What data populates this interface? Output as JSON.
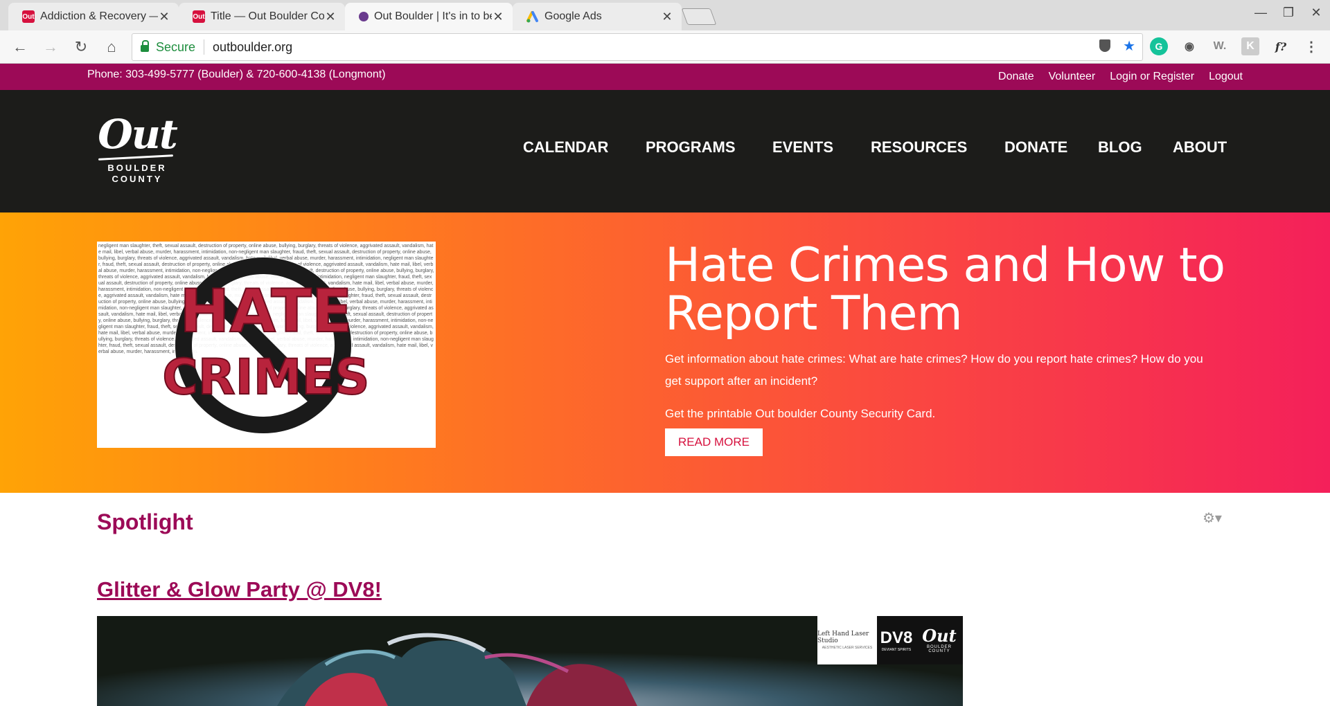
{
  "browser": {
    "tabs": [
      {
        "title": "Addiction & Recovery — O",
        "favicon_color": "#d6113e",
        "favicon_text": "Out",
        "active": false
      },
      {
        "title": "Title — Out Boulder Coun",
        "favicon_color": "#d6113e",
        "favicon_text": "Out",
        "active": false
      },
      {
        "title": "Out Boulder | It's in to be",
        "favicon_color": "#6a3b8e",
        "favicon_text": "",
        "active": true
      },
      {
        "title": "Google Ads",
        "favicon_color": "#4285f4",
        "favicon_text": "",
        "active": false
      }
    ],
    "close_glyph": "✕",
    "secure_label": "Secure",
    "url": "outboulder.org",
    "extensions": [
      "grammarly-icon",
      "evernote-icon",
      "w-icon",
      "k-icon",
      "fx-icon",
      "menu-icon"
    ],
    "ext_labels": {
      "w": "W.",
      "k": "K",
      "fx": "f?"
    }
  },
  "topbar": {
    "phone": "Phone: 303-499-5777 (Boulder) & 720-600-4138 (Longmont)",
    "links": [
      "Donate",
      "Volunteer",
      "Login or Register",
      "Logout"
    ]
  },
  "logo": {
    "main": "Out",
    "line1": "BOULDER",
    "line2": "COUNTY"
  },
  "nav": [
    "CALENDAR",
    "PROGRAMS",
    "EVENTS",
    "RESOURCES",
    "DONATE",
    "BLOG",
    "ABOUT"
  ],
  "hero": {
    "image_word1": "HATE",
    "image_word2": "CRIMES",
    "title": "Hate Crimes and How to Report Them",
    "description": "Get information about hate crimes: What are hate crimes? How do you report hate crimes? How do you get support after an incident?",
    "card_text": "Get the printable Out boulder County Security Card.",
    "button": "READ MORE"
  },
  "spotlight": {
    "heading": "Spotlight",
    "post_title": "Glitter & Glow Party @ DV8!",
    "sponsors": {
      "s1": "Left Hand Laser Studio",
      "s1_sub": "AESTHETIC LASER SERVICES",
      "s2": "DV8",
      "s2_sub": "DEVIANT SPIRITS",
      "s3": "Out",
      "s3_sub1": "BOULDER",
      "s3_sub2": "COUNTY"
    }
  },
  "colors": {
    "brand": "#9c0a57",
    "header_bg": "#1c1c1a",
    "hero_start": "#ffa306",
    "hero_end": "#f4205a",
    "button_text": "#d6113e"
  }
}
